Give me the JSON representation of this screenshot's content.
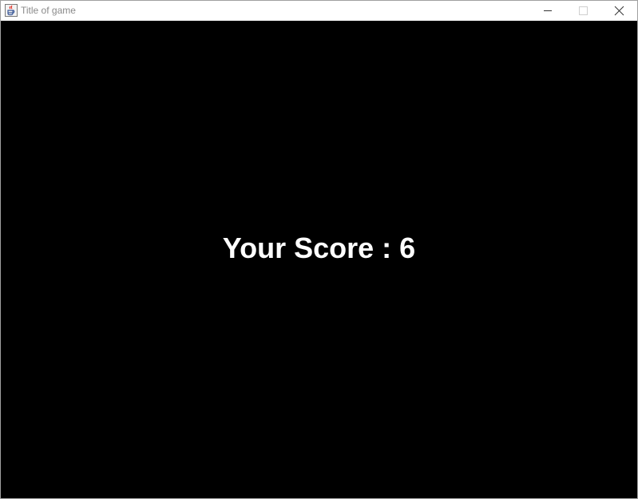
{
  "window": {
    "title": "Title of game",
    "icon": "java-icon",
    "controls": [
      "minimize-icon",
      "maximize-icon",
      "close-icon"
    ]
  },
  "game": {
    "score_text": "Your Score : 6",
    "background_color": "#000000",
    "text_color": "#ffffff"
  }
}
